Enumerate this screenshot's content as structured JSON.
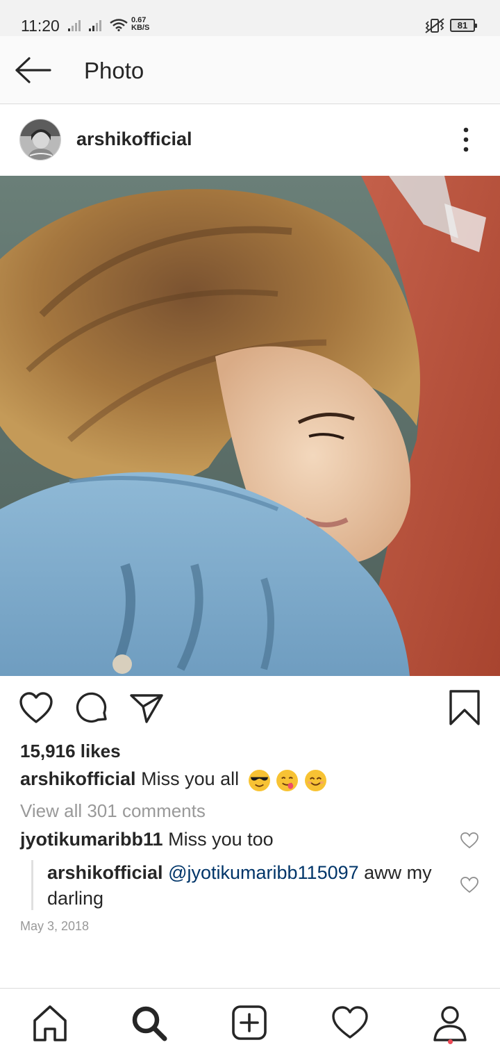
{
  "status_bar": {
    "time": "11:20",
    "net_speed_value": "0.67",
    "net_speed_unit": "KB/S",
    "battery": "81",
    "icons": [
      "signal-icon",
      "signal-icon",
      "wifi-icon",
      "vibrate-icon",
      "battery-icon"
    ]
  },
  "header": {
    "title": "Photo",
    "back_icon": "arrow-left-icon"
  },
  "post": {
    "username": "arshikofficial",
    "more_icon": "more-vertical-icon",
    "likes": "15,916 likes",
    "caption_user": "arshikofficial",
    "caption_text": "Miss you all",
    "caption_emojis": [
      "smiling-face-with-sunglasses",
      "face-savoring-food",
      "smiling-face-with-smiling-eyes"
    ],
    "view_all_comments": "View all 301 comments",
    "date": "May 3, 2018"
  },
  "comments": [
    {
      "user": "jyotikumaribb11",
      "text": "Miss you too"
    },
    {
      "user": "arshikofficial",
      "mention": "@jyotikumaribb115097",
      "text": "aww my",
      "text_line2": "darling"
    }
  ],
  "actions": [
    "heart-icon",
    "comment-icon",
    "share-icon",
    "bookmark-icon"
  ],
  "bottom_nav": [
    "home-icon",
    "search-icon",
    "add-icon",
    "activity-heart-icon",
    "profile-icon"
  ],
  "colors": {
    "text": "#262626",
    "muted": "#999999",
    "mention": "#003569",
    "notification": "#ed4956"
  }
}
